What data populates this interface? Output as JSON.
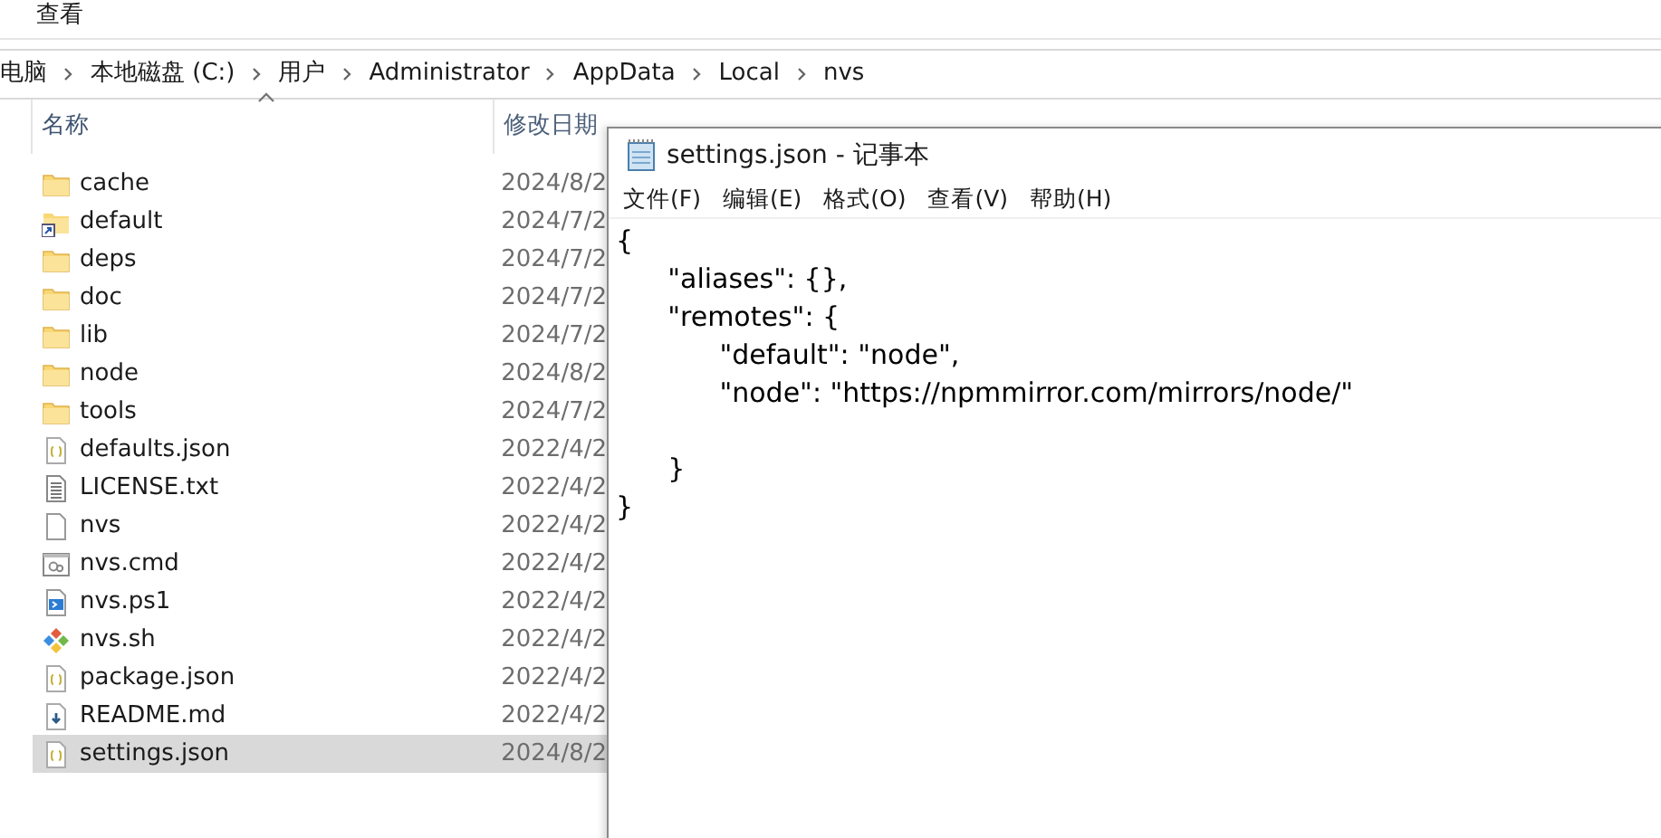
{
  "ribbon": {
    "tab": "查看"
  },
  "breadcrumb": [
    "电脑",
    "本地磁盘 (C:)",
    "用户",
    "Administrator",
    "AppData",
    "Local",
    "nvs"
  ],
  "columns": [
    {
      "label": "名称",
      "sorted": true
    },
    {
      "label": "修改日期",
      "sorted": false
    }
  ],
  "files": [
    {
      "name": "cache",
      "kind": "folder",
      "date": "2024/8/2",
      "selected": false
    },
    {
      "name": "default",
      "kind": "shortcut",
      "date": "2024/7/2",
      "selected": false
    },
    {
      "name": "deps",
      "kind": "folder",
      "date": "2024/7/2",
      "selected": false
    },
    {
      "name": "doc",
      "kind": "folder",
      "date": "2024/7/2",
      "selected": false
    },
    {
      "name": "lib",
      "kind": "folder",
      "date": "2024/7/2",
      "selected": false
    },
    {
      "name": "node",
      "kind": "folder",
      "date": "2024/8/2",
      "selected": false
    },
    {
      "name": "tools",
      "kind": "folder",
      "date": "2024/7/2",
      "selected": false
    },
    {
      "name": "defaults.json",
      "kind": "json",
      "date": "2022/4/2",
      "selected": false
    },
    {
      "name": "LICENSE.txt",
      "kind": "text",
      "date": "2022/4/2",
      "selected": false
    },
    {
      "name": "nvs",
      "kind": "blank",
      "date": "2022/4/2",
      "selected": false
    },
    {
      "name": "nvs.cmd",
      "kind": "cmd",
      "date": "2022/4/2",
      "selected": false
    },
    {
      "name": "nvs.ps1",
      "kind": "ps1",
      "date": "2022/4/2",
      "selected": false
    },
    {
      "name": "nvs.sh",
      "kind": "sh",
      "date": "2022/4/2",
      "selected": false
    },
    {
      "name": "package.json",
      "kind": "json",
      "date": "2022/4/2",
      "selected": false
    },
    {
      "name": "README.md",
      "kind": "md",
      "date": "2022/4/2",
      "selected": false
    },
    {
      "name": "settings.json",
      "kind": "json",
      "date": "2024/8/2",
      "selected": true
    }
  ],
  "notepad": {
    "title": "settings.json - 记事本",
    "menu": [
      "文件(F)",
      "编辑(E)",
      "格式(O)",
      "查看(V)",
      "帮助(H)"
    ],
    "content": "{\n\t\"aliases\": {},\n\t\"remotes\": {\n\t\t\"default\": \"node\",\n\t\t\"node\": \"https://npmmirror.com/mirrors/node/\"\n\n\t}\n}"
  }
}
